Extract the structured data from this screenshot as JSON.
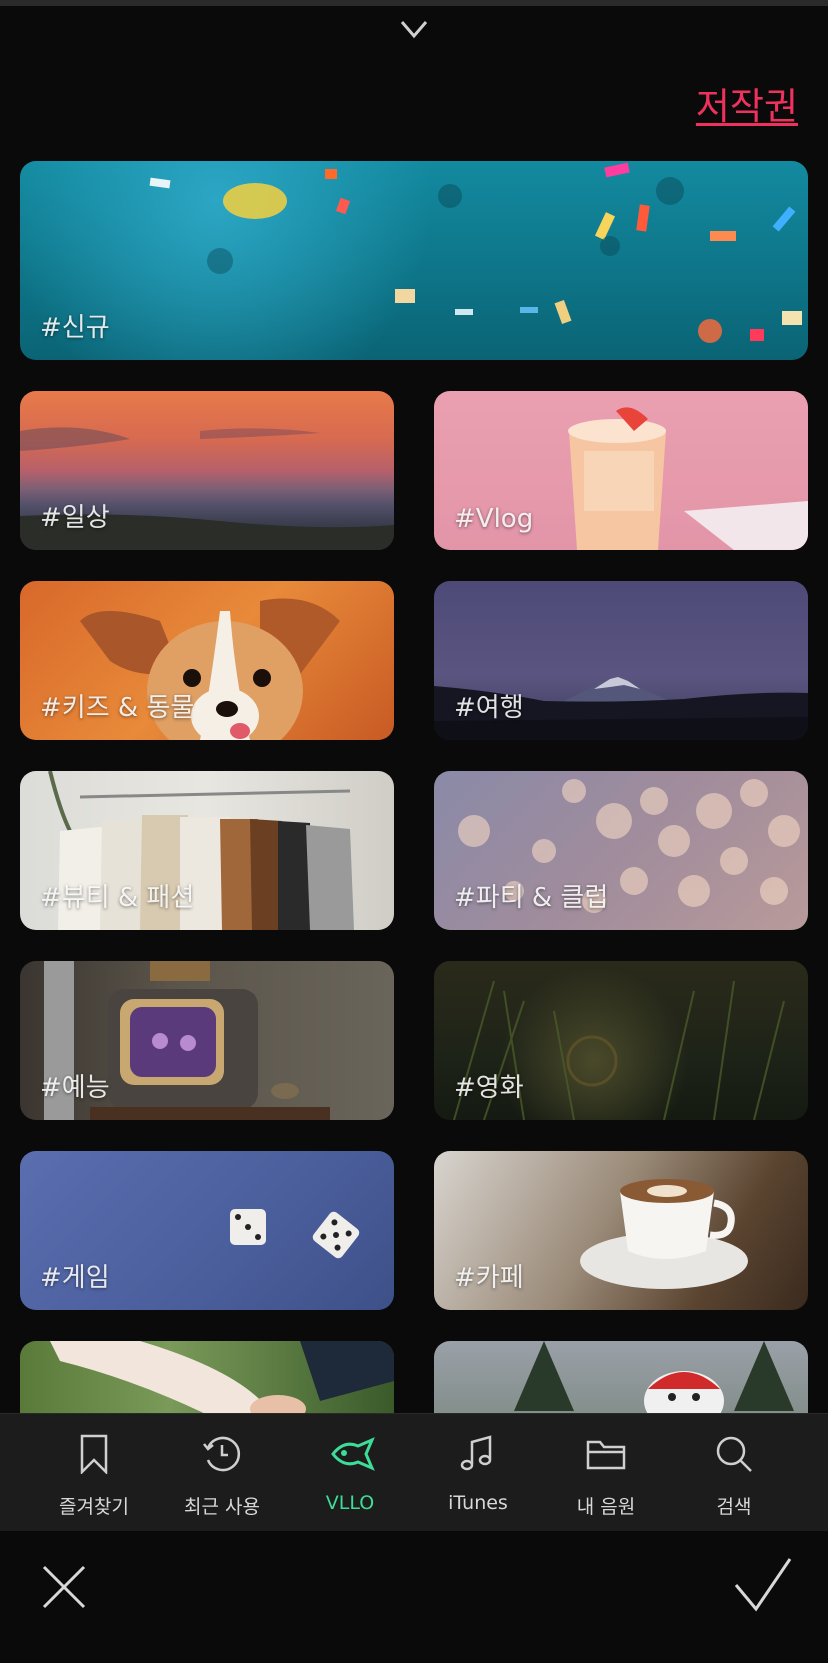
{
  "header": {
    "copyright_label": "저작권"
  },
  "categories": [
    {
      "label": "#신규"
    },
    {
      "label": "#일상"
    },
    {
      "label": "#Vlog"
    },
    {
      "label": "#키즈 & 동물"
    },
    {
      "label": "#여행"
    },
    {
      "label": "#뷰티 & 패션"
    },
    {
      "label": "#파티 & 클럽"
    },
    {
      "label": "#예능"
    },
    {
      "label": "#영화"
    },
    {
      "label": "#게임"
    },
    {
      "label": "#카페"
    }
  ],
  "tabs": [
    {
      "label": "즐겨찾기",
      "icon": "bookmark-icon"
    },
    {
      "label": "최근 사용",
      "icon": "history-clock-icon"
    },
    {
      "label": "VLLO",
      "icon": "vllo-fish-icon",
      "active": true
    },
    {
      "label": "iTunes",
      "icon": "music-note-icon"
    },
    {
      "label": "내 음원",
      "icon": "folder-icon"
    },
    {
      "label": "검색",
      "icon": "search-icon"
    }
  ],
  "colors": {
    "accent": "#3ddc97",
    "copyright": "#f0315d",
    "background": "#0a0a0a",
    "tabbar": "#1c1c1c"
  }
}
